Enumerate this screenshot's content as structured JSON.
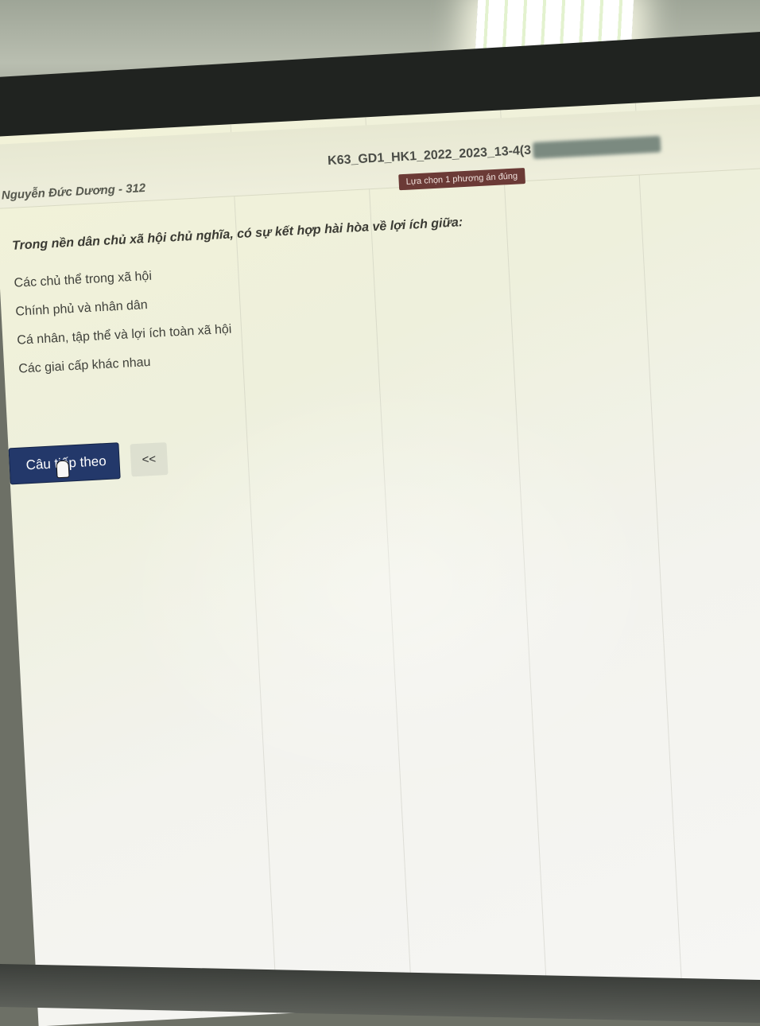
{
  "header": {
    "user_name": "Nguyễn Đức Dương - 312",
    "exam_title": "K63_GD1_HK1_2022_2023_13-4(3",
    "instruction": "Lựa chọn 1 phương án đúng"
  },
  "question": {
    "text": "Trong nền dân chủ xã hội chủ nghĩa, có sự kết hợp hài hòa về lợi ích giữa:",
    "options": [
      "Các chủ thể trong xã hội",
      "Chính phủ và nhân dân",
      "Cá nhân, tập thể và lợi ích toàn xã hội",
      "Các giai cấp khác nhau"
    ]
  },
  "navigation": {
    "next_label": "Câu tiếp theo",
    "back_label": "<<"
  }
}
